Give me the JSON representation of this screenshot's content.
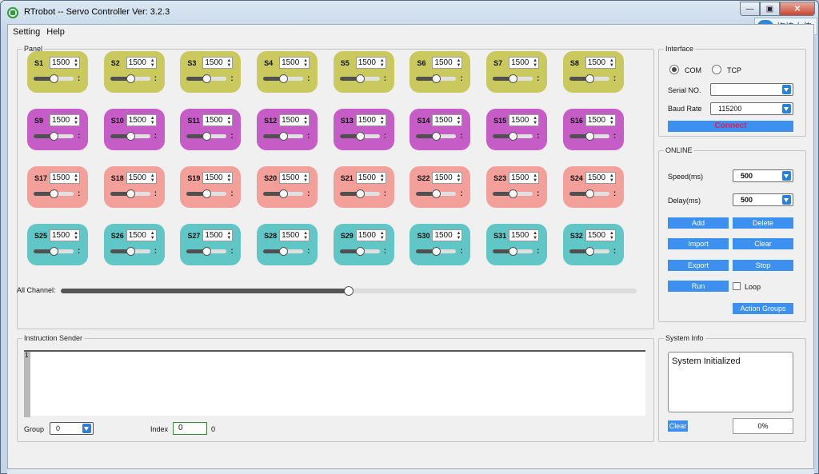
{
  "window": {
    "title": "RTrobot -- Servo Controller  Ver: 3.2.3"
  },
  "upload_badge": {
    "label": "拖拽上传"
  },
  "menu": [
    "Setting",
    "Help"
  ],
  "panel": {
    "legend": "Panel",
    "servos": [
      {
        "name": "S1",
        "value": "1500",
        "slider_fraction": 0.5,
        "color": "#c9c95e"
      },
      {
        "name": "S2",
        "value": "1500",
        "slider_fraction": 0.5,
        "color": "#c9c95e"
      },
      {
        "name": "S3",
        "value": "1500",
        "slider_fraction": 0.5,
        "color": "#c9c95e"
      },
      {
        "name": "S4",
        "value": "1500",
        "slider_fraction": 0.5,
        "color": "#c9c95e"
      },
      {
        "name": "S5",
        "value": "1500",
        "slider_fraction": 0.5,
        "color": "#c9c95e"
      },
      {
        "name": "S6",
        "value": "1500",
        "slider_fraction": 0.5,
        "color": "#c9c95e"
      },
      {
        "name": "S7",
        "value": "1500",
        "slider_fraction": 0.5,
        "color": "#c9c95e"
      },
      {
        "name": "S8",
        "value": "1500",
        "slider_fraction": 0.5,
        "color": "#c9c95e"
      },
      {
        "name": "S9",
        "value": "1500",
        "slider_fraction": 0.5,
        "color": "#c65cc6"
      },
      {
        "name": "S10",
        "value": "1500",
        "slider_fraction": 0.5,
        "color": "#c65cc6"
      },
      {
        "name": "S11",
        "value": "1500",
        "slider_fraction": 0.5,
        "color": "#c65cc6"
      },
      {
        "name": "S12",
        "value": "1500",
        "slider_fraction": 0.5,
        "color": "#c65cc6"
      },
      {
        "name": "S13",
        "value": "1500",
        "slider_fraction": 0.5,
        "color": "#c65cc6"
      },
      {
        "name": "S14",
        "value": "1500",
        "slider_fraction": 0.5,
        "color": "#c65cc6"
      },
      {
        "name": "S15",
        "value": "1500",
        "slider_fraction": 0.5,
        "color": "#c65cc6"
      },
      {
        "name": "S16",
        "value": "1500",
        "slider_fraction": 0.5,
        "color": "#c65cc6"
      },
      {
        "name": "S17",
        "value": "1500",
        "slider_fraction": 0.5,
        "color": "#f4a09a"
      },
      {
        "name": "S18",
        "value": "1500",
        "slider_fraction": 0.5,
        "color": "#f4a09a"
      },
      {
        "name": "S19",
        "value": "1500",
        "slider_fraction": 0.5,
        "color": "#f4a09a"
      },
      {
        "name": "S20",
        "value": "1500",
        "slider_fraction": 0.5,
        "color": "#f4a09a"
      },
      {
        "name": "S21",
        "value": "1500",
        "slider_fraction": 0.5,
        "color": "#f4a09a"
      },
      {
        "name": "S22",
        "value": "1500",
        "slider_fraction": 0.5,
        "color": "#f4a09a"
      },
      {
        "name": "S23",
        "value": "1500",
        "slider_fraction": 0.5,
        "color": "#f4a09a"
      },
      {
        "name": "S24",
        "value": "1500",
        "slider_fraction": 0.5,
        "color": "#f4a09a"
      },
      {
        "name": "S25",
        "value": "1500",
        "slider_fraction": 0.5,
        "color": "#60c6c6"
      },
      {
        "name": "S26",
        "value": "1500",
        "slider_fraction": 0.5,
        "color": "#60c6c6"
      },
      {
        "name": "S27",
        "value": "1500",
        "slider_fraction": 0.5,
        "color": "#60c6c6"
      },
      {
        "name": "S28",
        "value": "1500",
        "slider_fraction": 0.5,
        "color": "#60c6c6"
      },
      {
        "name": "S29",
        "value": "1500",
        "slider_fraction": 0.5,
        "color": "#60c6c6"
      },
      {
        "name": "S30",
        "value": "1500",
        "slider_fraction": 0.5,
        "color": "#60c6c6"
      },
      {
        "name": "S31",
        "value": "1500",
        "slider_fraction": 0.5,
        "color": "#60c6c6"
      },
      {
        "name": "S32",
        "value": "1500",
        "slider_fraction": 0.5,
        "color": "#60c6c6"
      }
    ],
    "separator": ":",
    "all_channel": {
      "label": "All Channel:",
      "fraction": 0.5
    }
  },
  "interface": {
    "legend": "Interface",
    "com_label": "COM",
    "tcp_label": "TCP",
    "selected": "COM",
    "serial_label": "Serial NO.",
    "serial_value": "",
    "baud_label": "Baud Rate",
    "baud_value": "115200",
    "connect_label": "Connect"
  },
  "online": {
    "legend": "ONLINE",
    "speed_label": "Speed(ms)",
    "speed_value": "500",
    "delay_label": "Delay(ms)",
    "delay_value": "500",
    "add": "Add",
    "delete": "Delete",
    "import": "Import",
    "clear": "Clear",
    "export": "Export",
    "stop": "Stop",
    "run": "Run",
    "loop_label": "Loop",
    "loop_checked": false,
    "action_groups": "Action Groups"
  },
  "sender": {
    "legend": "Instruction Sender",
    "line_number": "1",
    "group_label": "Group",
    "group_value": "0",
    "index_label": "Index",
    "index_value": "0",
    "index_count": "0"
  },
  "sysinfo": {
    "legend": "System Info",
    "text": "System Initialized",
    "clear": "Clear",
    "progress": "0%"
  },
  "colors": {
    "button_blue": "#3c90f0",
    "connect_text": "#e8195a"
  }
}
